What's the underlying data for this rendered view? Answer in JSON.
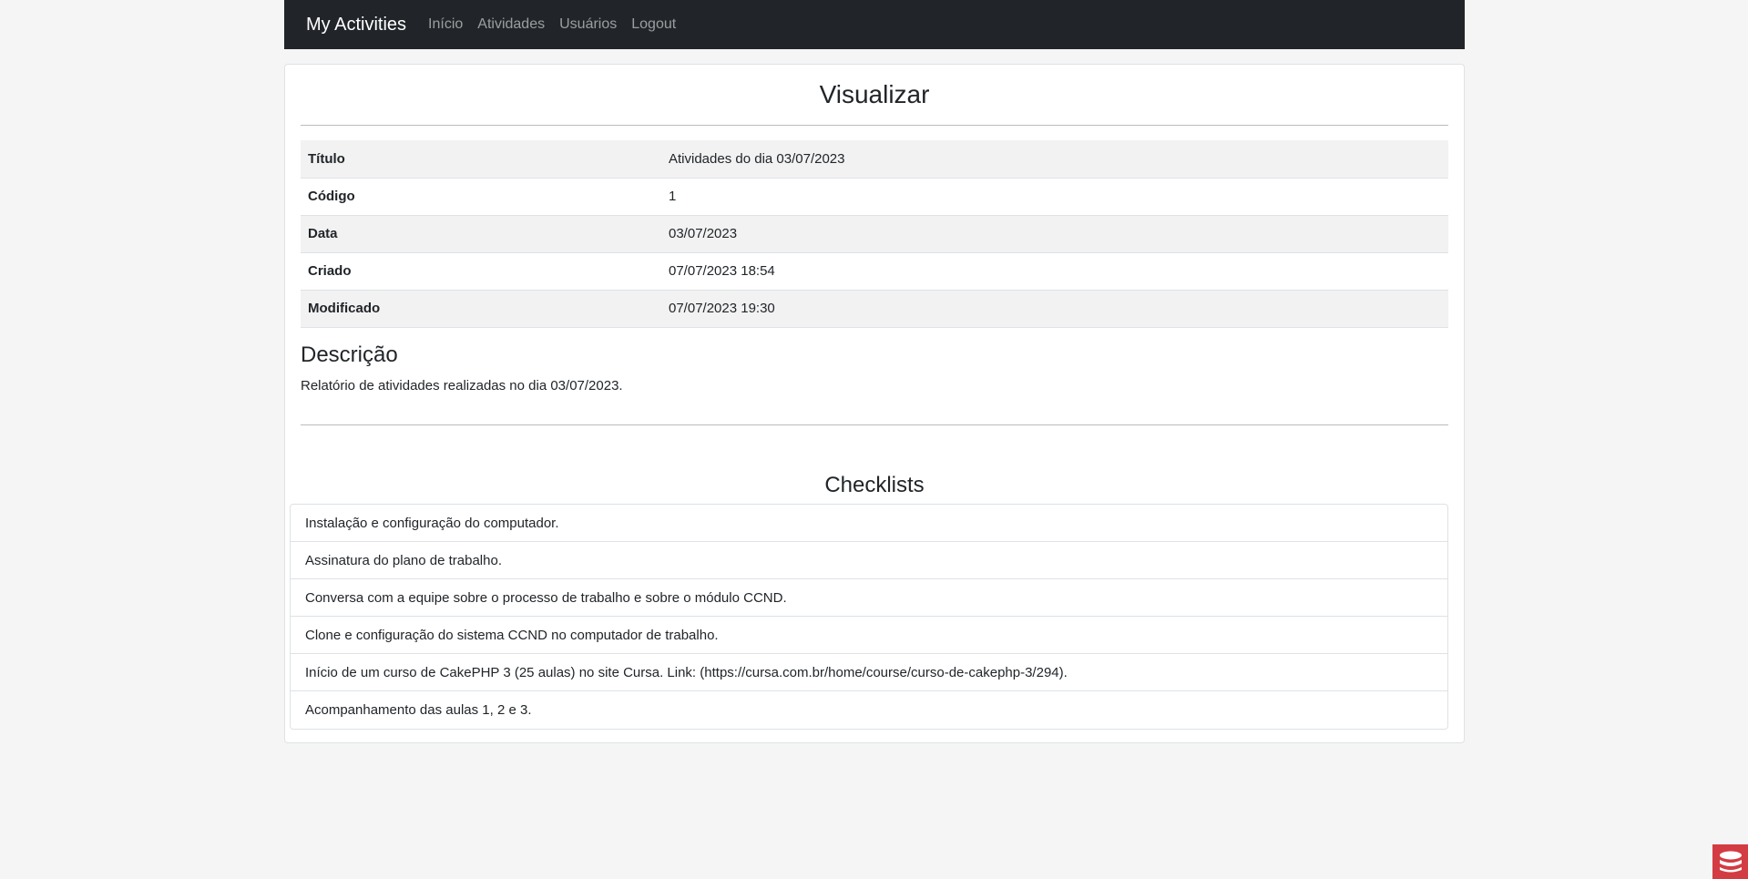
{
  "navbar": {
    "brand": "My Activities",
    "links": [
      "Início",
      "Atividades",
      "Usuários",
      "Logout"
    ]
  },
  "page": {
    "title": "Visualizar"
  },
  "details": [
    {
      "label": "Título",
      "value": "Atividades do dia 03/07/2023"
    },
    {
      "label": "Código",
      "value": "1"
    },
    {
      "label": "Data",
      "value": "03/07/2023"
    },
    {
      "label": "Criado",
      "value": "07/07/2023 18:54"
    },
    {
      "label": "Modificado",
      "value": "07/07/2023 19:30"
    }
  ],
  "description": {
    "title": "Descrição",
    "text": "Relatório de atividades realizadas no dia 03/07/2023."
  },
  "checklists": {
    "title": "Checklists",
    "items": [
      "Instalação e configuração do computador.",
      "Assinatura do plano de trabalho.",
      "Conversa com a equipe sobre o processo de trabalho e sobre o módulo CCND.",
      "Clone e configuração do sistema CCND no computador de trabalho.",
      "Início de um curso de CakePHP 3 (25 aulas) no site Cursa. Link: (https://cursa.com.br/home/course/curso-de-cakephp-3/294).",
      "Acompanhamento das aulas 1, 2 e 3."
    ]
  },
  "colors": {
    "navbar_bg": "#212529",
    "page_bg": "#f5f5f5",
    "cake_icon_bg": "#d33c43"
  },
  "icons": {
    "debug_kit": "cakephp-icon"
  }
}
